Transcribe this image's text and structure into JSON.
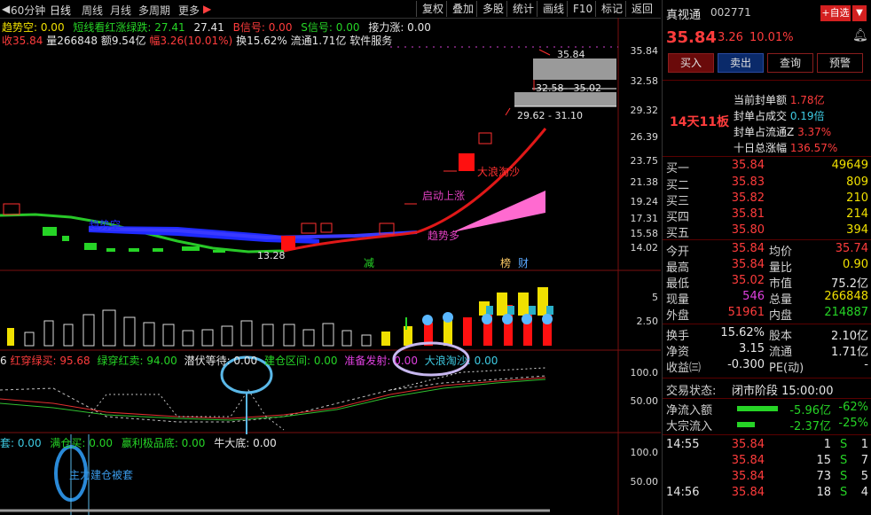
{
  "toolbar": {
    "tabs": [
      "60分钟",
      "日线",
      "周线",
      "月线",
      "多周期",
      "更多"
    ],
    "buttons": [
      "复权",
      "叠加",
      "多股",
      "统计",
      "画线",
      "F10",
      "标记",
      "返回"
    ]
  },
  "indicator_header": {
    "a": "趋势空: 0.00",
    "b": "短线看红涨绿跌: 27.41",
    "c": "27.41",
    "d": "B信号: 0.00",
    "e": "S信号: 0.00",
    "f": "接力涨: 0.00"
  },
  "info_line": {
    "a": "收35.84",
    "b": "量266848",
    "c": "额9.54亿",
    "d": "幅3.26(10.01%)",
    "e": "换15.62%",
    "f": "流通1.71亿",
    "g": "软件服务"
  },
  "price_axis": [
    "35.84",
    "32.58",
    "29.32",
    "26.39",
    "23.75",
    "21.38",
    "19.24",
    "17.31",
    "15.58",
    "14.02"
  ],
  "vol_axis": [
    "5",
    "2.50"
  ],
  "osc_axis": [
    "100.0",
    "50.00"
  ],
  "bottom_axis": [
    "100.0",
    "50.00"
  ],
  "annotations": {
    "high_marker": "35.84",
    "range1": "32.58 - 35.02",
    "range2": "29.62 - 31.10",
    "low_marker": "13.28",
    "trend_empty": "趋势空",
    "trend_many": "趋势多",
    "big_wave": "大浪淘沙",
    "start_up": "启动上涨",
    "reduce": "减",
    "rank": "榜",
    "wealth": "财"
  },
  "osc_header": {
    "a": "红穿绿买: 95.68",
    "b": "绿穿红卖: 94.00",
    "c": "潜伏等待: 0.00",
    "d": "建仓区间: 0.00",
    "e": "准备发射: 0.00",
    "f": "大浪淘沙: 0.00",
    "prefix": "6"
  },
  "bottom_header": {
    "a": "套: 0.00",
    "b": "满仓买: 0.00",
    "c": "赢利极品底: 0.00",
    "d": "牛大底: 0.00"
  },
  "bottom_annotation": "主力建仓被套",
  "stock": {
    "name": "真视通",
    "code": "002771",
    "price": "35.84",
    "change": "3.26",
    "change_pct": "10.01%",
    "add_button": "+自选",
    "actions": [
      "买入",
      "卖出",
      "查询",
      "预警"
    ]
  },
  "limit_up": {
    "badge": "14天11板",
    "rows": [
      {
        "label": "当前封单额",
        "value": "1.78亿"
      },
      {
        "label": "封单占成交",
        "value": "0.19倍"
      },
      {
        "label": "封单占流通Z",
        "value": "3.37%"
      },
      {
        "label": "十日总涨幅",
        "value": "136.57%"
      }
    ]
  },
  "order_book": [
    {
      "label": "买一",
      "price": "35.84",
      "vol": "49649"
    },
    {
      "label": "买二",
      "price": "35.83",
      "vol": "809"
    },
    {
      "label": "买三",
      "price": "35.82",
      "vol": "210"
    },
    {
      "label": "买四",
      "price": "35.81",
      "vol": "214"
    },
    {
      "label": "买五",
      "price": "35.80",
      "vol": "394"
    }
  ],
  "quote": [
    {
      "l1": "今开",
      "v1": "35.84",
      "l2": "均价",
      "v2": "35.74"
    },
    {
      "l1": "最高",
      "v1": "35.84",
      "l2": "量比",
      "v2": "0.90"
    },
    {
      "l1": "最低",
      "v1": "35.02",
      "l2": "市值",
      "v2": "75.2亿"
    },
    {
      "l1": "现量",
      "v1": "546",
      "l2": "总量",
      "v2": "266848"
    },
    {
      "l1": "外盘",
      "v1": "51961",
      "l2": "内盘",
      "v2": "214887"
    }
  ],
  "fund": [
    {
      "l1": "换手",
      "v1": "15.62%",
      "l2": "股本",
      "v2": "2.10亿"
    },
    {
      "l1": "净资",
      "v1": "3.15",
      "l2": "流通",
      "v2": "1.71亿"
    },
    {
      "l1": "收益㈢",
      "v1": "-0.300",
      "l2": "PE(动)",
      "v2": "-"
    }
  ],
  "trade_status": {
    "label": "交易状态:",
    "value": "闭市阶段 15:00:00"
  },
  "flows": [
    {
      "label": "净流入额",
      "value": "-5.96亿",
      "pct": "-62%"
    },
    {
      "label": "大宗流入",
      "value": "-2.37亿",
      "pct": "-25%"
    }
  ],
  "ticks": [
    {
      "time": "14:55",
      "price": "35.84",
      "vol": "1",
      "side": "S",
      "extra": "1"
    },
    {
      "time": "",
      "price": "35.84",
      "vol": "15",
      "side": "S",
      "extra": "7"
    },
    {
      "time": "",
      "price": "35.84",
      "vol": "73",
      "side": "S",
      "extra": "5"
    },
    {
      "time": "14:56",
      "price": "35.84",
      "vol": "18",
      "side": "S",
      "extra": "4"
    }
  ],
  "colors": {
    "up": "#ff3c3c",
    "down": "#26d426",
    "accent": "#e8a000",
    "bg": "#000000"
  }
}
